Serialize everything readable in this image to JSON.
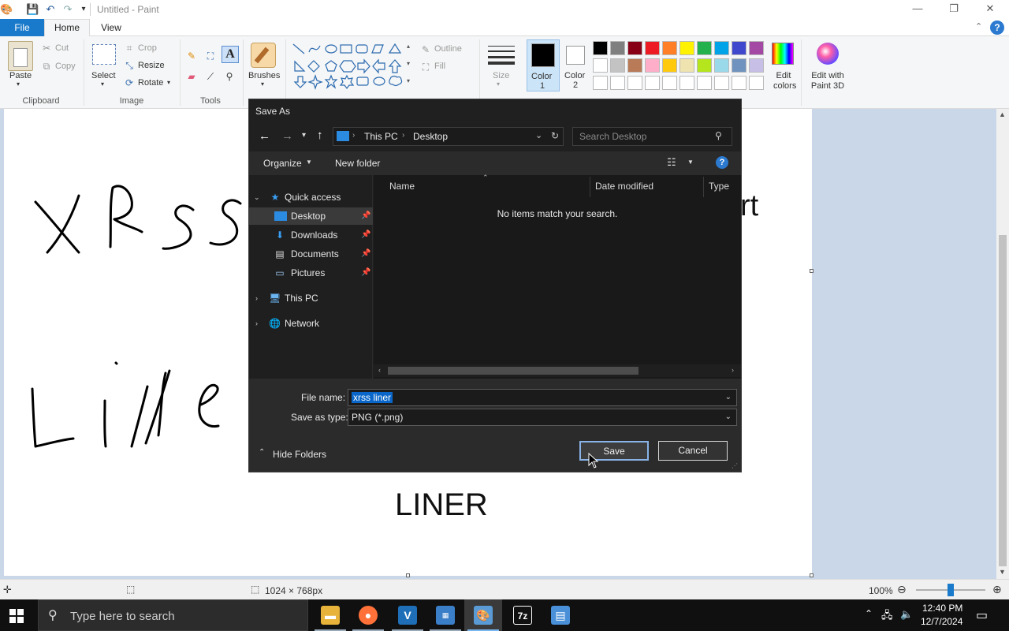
{
  "window": {
    "title": "Untitled - Paint"
  },
  "tabs": {
    "file": "File",
    "home": "Home",
    "view": "View"
  },
  "clipboard": {
    "paste": "Paste",
    "cut": "Cut",
    "copy": "Copy",
    "label": "Clipboard"
  },
  "image": {
    "select": "Select",
    "crop": "Crop",
    "resize": "Resize",
    "rotate": "Rotate",
    "label": "Image"
  },
  "tools": {
    "label": "Tools"
  },
  "brushes": {
    "label": "Brushes"
  },
  "shapes": {
    "outline": "Outline",
    "fill": "Fill"
  },
  "size": {
    "label": "Size"
  },
  "colors": {
    "color1_label": "Color",
    "color1_num": "1",
    "color2_label": "Color",
    "color2_num": "2",
    "edit_colors": "Edit colors",
    "edit_paint3d": "Edit with Paint 3D",
    "row1": [
      "#000000",
      "#7f7f7f",
      "#880015",
      "#ed1c24",
      "#ff7f27",
      "#fff200",
      "#22b14c",
      "#00a2e8",
      "#3f48cc",
      "#a349a4"
    ],
    "row2": [
      "#ffffff",
      "#c3c3c3",
      "#b97a57",
      "#ffaec9",
      "#ffc90e",
      "#efe4b0",
      "#b5e61d",
      "#99d9ea",
      "#7092be",
      "#c8bfe7"
    ]
  },
  "canvas_text": {
    "partial_text": "rt",
    "liner_text": "LINER"
  },
  "dialog": {
    "title": "Save As",
    "breadcrumb": [
      "This PC",
      "Desktop"
    ],
    "search_placeholder": "Search Desktop",
    "organize": "Organize",
    "new_folder": "New folder",
    "nav": {
      "quick_access": "Quick access",
      "desktop": "Desktop",
      "downloads": "Downloads",
      "documents": "Documents",
      "pictures": "Pictures",
      "this_pc": "This PC",
      "network": "Network"
    },
    "columns": {
      "name": "Name",
      "date_modified": "Date modified",
      "type": "Type"
    },
    "empty_message": "No items match your search.",
    "file_name_label": "File name:",
    "file_name_value": "xrss liner",
    "save_type_label": "Save as type:",
    "save_type_value": "PNG (*.png)",
    "hide_folders": "Hide Folders",
    "save": "Save",
    "cancel": "Cancel"
  },
  "status": {
    "dimensions": "1024 × 768px",
    "zoom": "100%"
  },
  "taskbar": {
    "search_placeholder": "Type here to search",
    "time": "12:40 PM",
    "date": "12/7/2024"
  }
}
